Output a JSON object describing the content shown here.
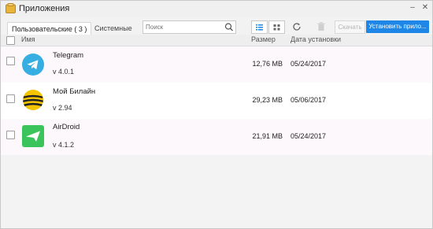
{
  "window": {
    "title": "Приложения"
  },
  "tabs": [
    {
      "label": "Пользовательские ( 3 )",
      "active": true
    },
    {
      "label": "Системные",
      "active": false
    }
  ],
  "search": {
    "placeholder": "Поиск",
    "value": ""
  },
  "toolbar": {
    "list_view_icon": "list-view-icon",
    "grid_view_icon": "grid-view-icon",
    "refresh_icon": "refresh-icon",
    "delete_icon": "trash-icon",
    "download_label": "Скачать",
    "install_label": "Установить прило..."
  },
  "columns": {
    "name": "Имя",
    "size": "Размер",
    "date": "Дата установки"
  },
  "apps": [
    {
      "name": "Telegram",
      "version": "v 4.0.1",
      "size": "12,76 MB",
      "date": "05/24/2017",
      "icon": "telegram-icon",
      "color": "#37aee2"
    },
    {
      "name": "Мой Билайн",
      "version": "v 2.94",
      "size": "29,23 MB",
      "date": "05/06/2017",
      "icon": "beeline-icon",
      "color": "#f5c400"
    },
    {
      "name": "AirDroid",
      "version": "v 4.1.2",
      "size": "21,91 MB",
      "date": "05/24/2017",
      "icon": "airdroid-icon",
      "color": "#3bc45c"
    }
  ],
  "colors": {
    "accent": "#1e86e6",
    "window_bg": "#f2f2f2",
    "row_alt": "#fdf8fb"
  }
}
